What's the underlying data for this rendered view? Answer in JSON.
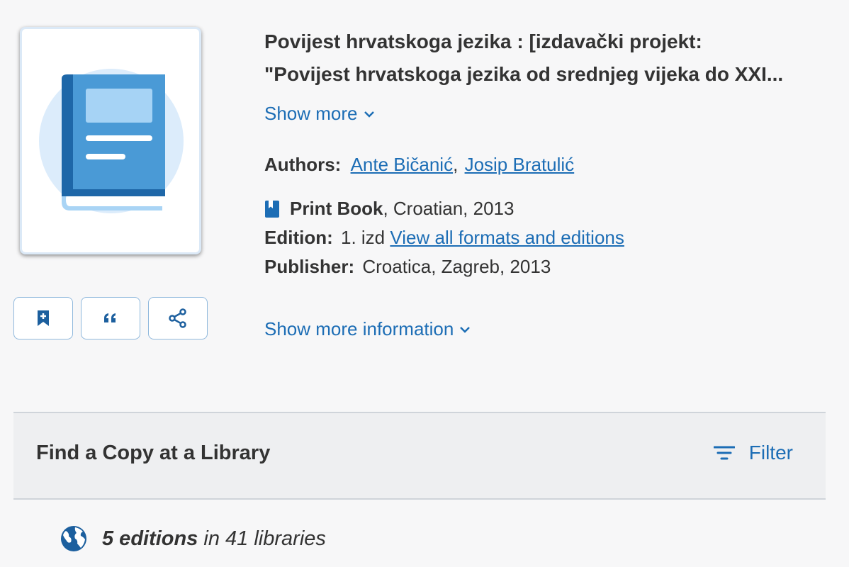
{
  "book": {
    "title_line1": "Povijest hrvatskoga jezika : [izdavački projekt:",
    "title_line2": "\"Povijest hrvatskoga jezika od srednjeg vijeka do XXI...",
    "show_more_label": "Show more",
    "authors_label": "Authors:",
    "authors": [
      "Ante Bičanić",
      "Josip Bratulić"
    ],
    "author_separator": ",",
    "format_label": "Print Book",
    "format_rest": ", Croatian, 2013",
    "edition_label": "Edition:",
    "edition_value": "1. izd",
    "view_editions_label": "View all formats and editions",
    "publisher_label": "Publisher:",
    "publisher_value": "Croatica, Zagreb, 2013",
    "show_more_info_label": "Show more information"
  },
  "actions": {
    "icons": [
      "bookmark-add-icon",
      "quote-icon",
      "share-icon"
    ]
  },
  "find_copy": {
    "title": "Find a Copy at a Library",
    "filter_label": "Filter"
  },
  "editions_summary": {
    "editions_count": "5 editions",
    "libraries_text": " in 41 libraries"
  },
  "colors": {
    "link": "#1c6db5",
    "book_icon_dark": "#2b7bbf",
    "book_icon_light": "#5aaee8"
  }
}
